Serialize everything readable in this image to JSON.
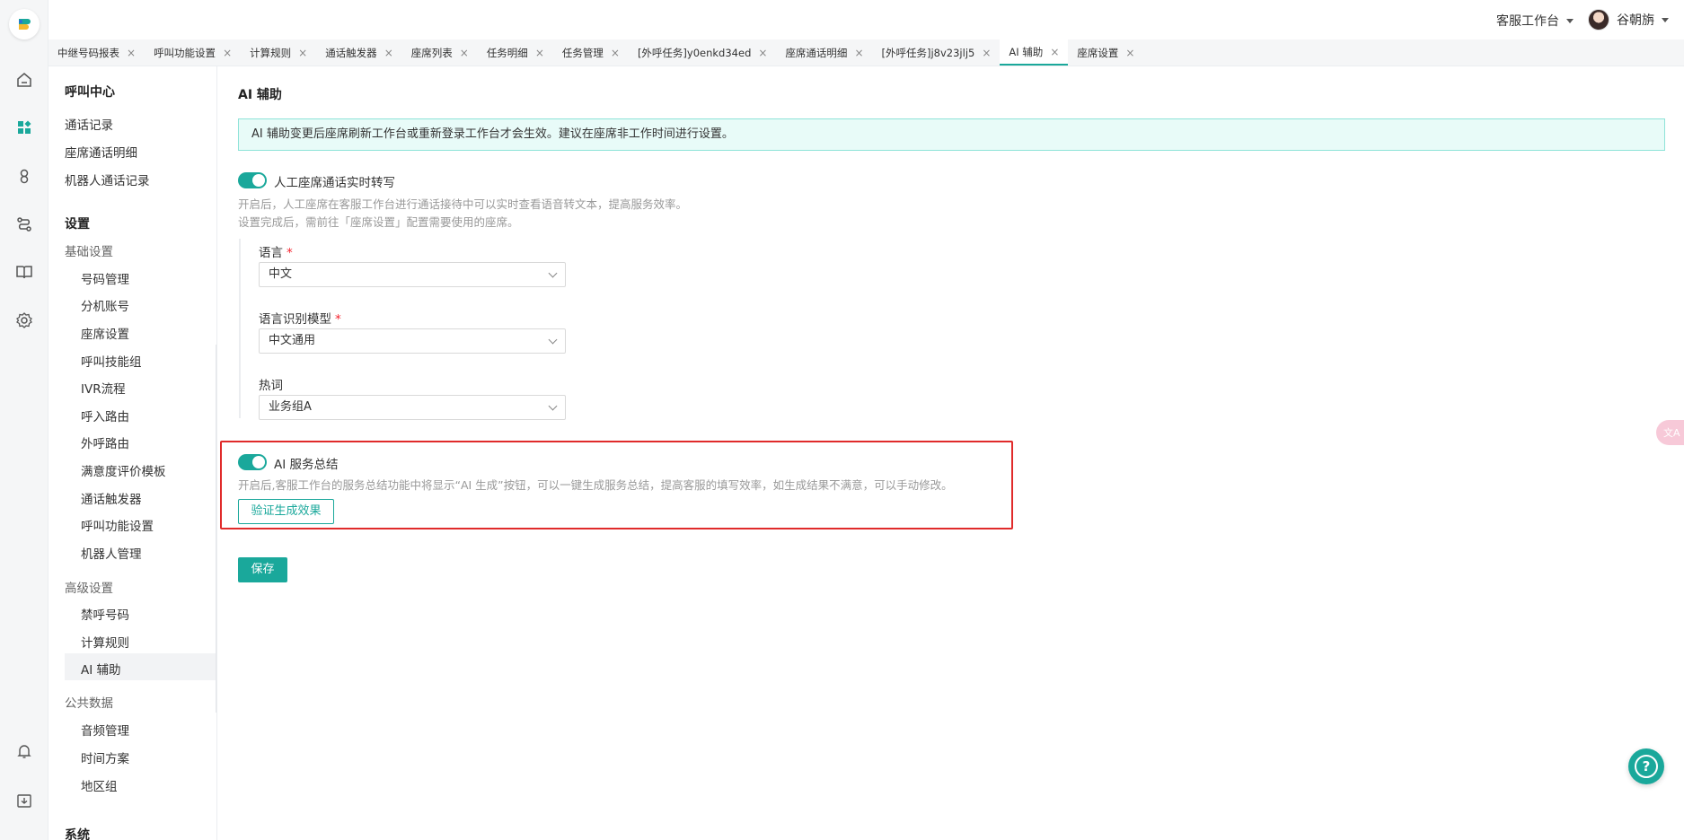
{
  "header": {
    "workspace_label": "客服工作台",
    "user_name": "谷朝旃"
  },
  "tabs": [
    {
      "label": "中继号码报表"
    },
    {
      "label": "呼叫功能设置"
    },
    {
      "label": "计算规则"
    },
    {
      "label": "通话触发器"
    },
    {
      "label": "座席列表"
    },
    {
      "label": "任务明细"
    },
    {
      "label": "任务管理"
    },
    {
      "label": "[外呼任务]y0enkd34ed"
    },
    {
      "label": "座席通话明细"
    },
    {
      "label": "[外呼任务]j8v23jlj5"
    },
    {
      "label": "AI 辅助",
      "active": true
    },
    {
      "label": "座席设置"
    }
  ],
  "sidebar": {
    "section_call_center": "呼叫中心",
    "items_call": [
      "通话记录",
      "座席通话明细",
      "机器人通话记录"
    ],
    "section_settings": "设置",
    "group_basic": "基础设置",
    "basic_items": [
      "号码管理",
      "分机账号",
      "座席设置",
      "呼叫技能组",
      "IVR流程",
      "呼入路由",
      "外呼路由",
      "满意度评价模板",
      "通话触发器",
      "呼叫功能设置",
      "机器人管理"
    ],
    "group_advanced": "高级设置",
    "advanced_items": [
      "禁呼号码",
      "计算规则",
      "AI 辅助"
    ],
    "group_public": "公共数据",
    "public_items": [
      "音频管理",
      "时间方案",
      "地区组"
    ],
    "section_system": "系统"
  },
  "main": {
    "title": "AI 辅助",
    "notice": "AI 辅助变更后座席刷新工作台或重新登录工作台才会生效。建议在座席非工作时间进行设置。",
    "realtime": {
      "label": "人工座席通话实时转写",
      "enabled": true,
      "desc1": "开启后，人工座席在客服工作台进行通话接待中可以实时查看语音转文本，提高服务效率。",
      "desc2": "设置完成后，需前往「座席设置」配置需要使用的座席。"
    },
    "language": {
      "label": "语言",
      "value": "中文"
    },
    "asr_model": {
      "label": "语言识别模型",
      "value": "中文通用"
    },
    "hotword": {
      "label": "热词",
      "value": "业务组A"
    },
    "summary": {
      "label": "AI 服务总结",
      "enabled": true,
      "desc": "开启后,客服工作台的服务总结功能中将显示“AI 生成”按钮，可以一键生成服务总结，提高客服的填写效率，如生成结果不满意，可以手动修改。",
      "verify_button": "验证生成效果"
    },
    "save_button": "保存"
  },
  "floating": {
    "translate_text": "文A",
    "help_text": "?"
  },
  "colors": {
    "accent": "#1aa89b",
    "highlight_border": "#e02b2b",
    "notice_bg": "#e8fbf8"
  }
}
